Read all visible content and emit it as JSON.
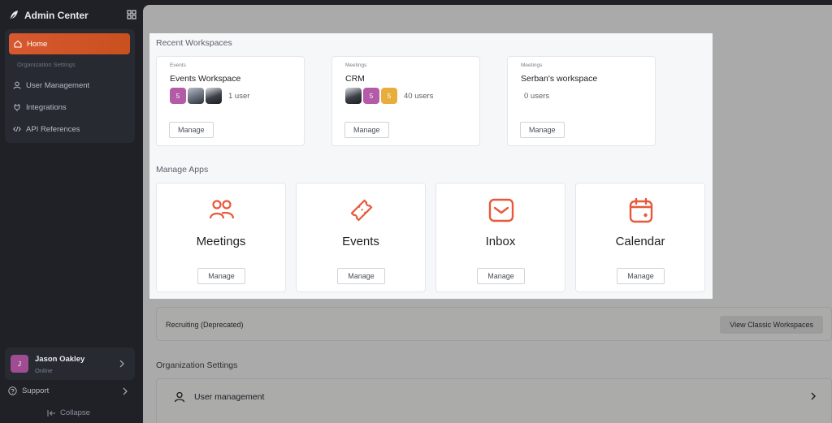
{
  "sidebar": {
    "brand": "Admin Center",
    "home": "Home",
    "sub_label": "Organization Settings",
    "items": [
      {
        "label": "User Management",
        "icon": "user-icon"
      },
      {
        "label": "Integrations",
        "icon": "plug-icon"
      },
      {
        "label": "API References",
        "icon": "code-icon"
      }
    ],
    "profile": {
      "initial": "J",
      "name": "Jason Oakley",
      "status": "Online"
    },
    "support": "Support",
    "collapse": "Collapse"
  },
  "recent": {
    "title": "Recent Workspaces",
    "workspaces": [
      {
        "type": "Events",
        "name": "Events Workspace",
        "count": "1 user",
        "badge": "5",
        "manage": "Manage"
      },
      {
        "type": "Meetings",
        "name": "CRM",
        "count": "40 users",
        "badges": [
          "5",
          "5"
        ],
        "manage": "Manage"
      },
      {
        "type": "Meetings",
        "name": "Serban's workspace",
        "count": "0 users",
        "manage": "Manage"
      }
    ]
  },
  "apps": {
    "title": "Manage Apps",
    "items": [
      {
        "name": "Meetings",
        "icon": "users-icon",
        "manage": "Manage"
      },
      {
        "name": "Events",
        "icon": "ticket-icon",
        "manage": "Manage"
      },
      {
        "name": "Inbox",
        "icon": "inbox-icon",
        "manage": "Manage"
      },
      {
        "name": "Calendar",
        "icon": "calendar-icon",
        "manage": "Manage"
      }
    ]
  },
  "recruiting": {
    "label": "Recruiting (Deprecated)",
    "button": "View Classic Workspaces"
  },
  "org": {
    "title": "Organization Settings",
    "item": "User management"
  },
  "colors": {
    "accent": "#e8593a",
    "sidebar": "#1f2127",
    "overlay": "#a9aaa9"
  }
}
